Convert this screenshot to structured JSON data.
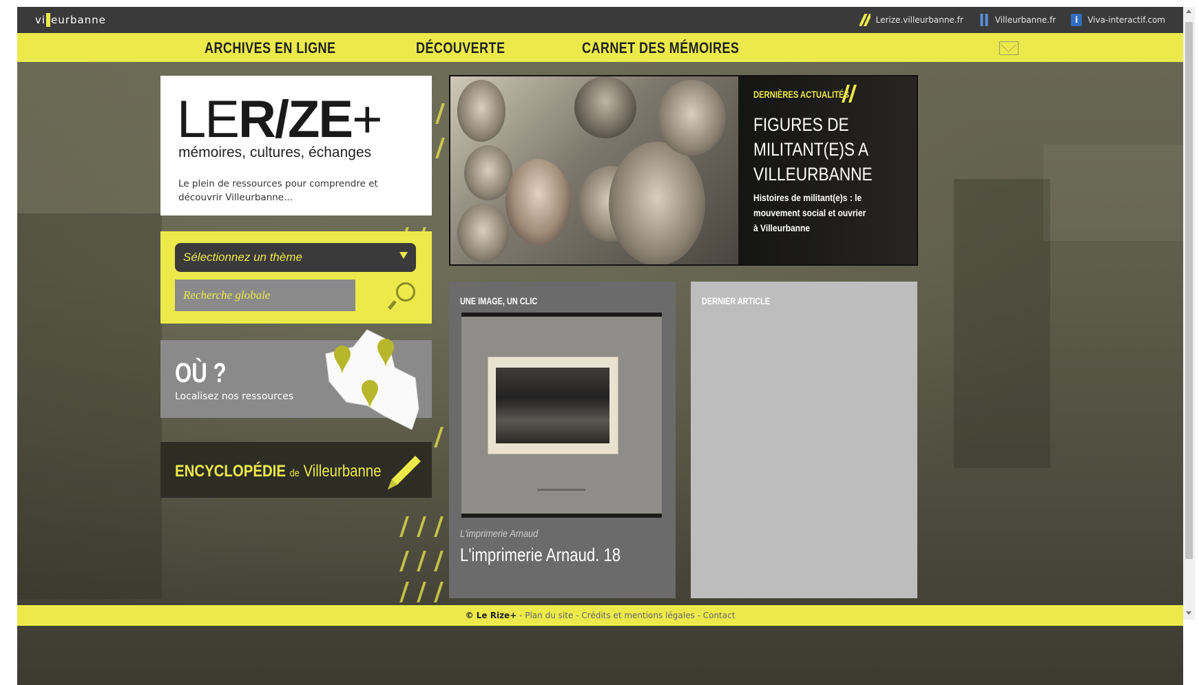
{
  "topbar": {
    "logo": "villeurbanne",
    "links": [
      {
        "icon": "slash-icon",
        "label": "Lerize.villeurbanne.fr"
      },
      {
        "icon": "villeurbanne-icon",
        "label": "Villeurbanne.fr"
      },
      {
        "icon": "viva-icon",
        "label": "Viva-interactif.com"
      }
    ]
  },
  "nav": {
    "items": [
      "ARCHIVES EN LIGNE",
      "DÉCOUVERTE",
      "CARNET DES MÉMOIRES"
    ],
    "mail_icon": "envelope-icon"
  },
  "brand": {
    "logo_thin": "LE",
    "logo_bold": "R/ZE",
    "logo_plus": "+",
    "tagline": "mémoires, cultures, échanges",
    "description": "Le plein de ressources pour comprendre et découvrir Villeurbanne..."
  },
  "search": {
    "theme_select": "Sélectionnez un thème",
    "global_placeholder": "Recherche globale"
  },
  "ou": {
    "title": "OÙ ?",
    "subtitle": "Localisez nos ressources"
  },
  "encyclopedie": {
    "label": "ENCYCLOPÉDIE",
    "de": "de",
    "place": "Villeurbanne"
  },
  "hero": {
    "kicker": "DERNIÈRES ACTUALITÉS",
    "title": "FIGURES DE MILITANT(E)S A VILLEURBANNE",
    "description": "Histoires de militant(e)s : le mouvement social et ouvrier à Villeurbanne"
  },
  "image_card": {
    "heading": "UNE IMAGE, UN CLIC",
    "caption": "L'imprimerie Arnaud",
    "title": "L'imprimerie Arnaud. 18"
  },
  "article_card": {
    "heading": "DERNIER ARTICLE"
  },
  "footer": {
    "copyright": "© Le Rize+",
    "links": [
      "Plan du site",
      "Crédits et mentions légales",
      "Contact"
    ]
  },
  "colors": {
    "accent": "#ecea4b",
    "topbar": "#3a3a3a",
    "card_gray": "#8a8a8a"
  }
}
